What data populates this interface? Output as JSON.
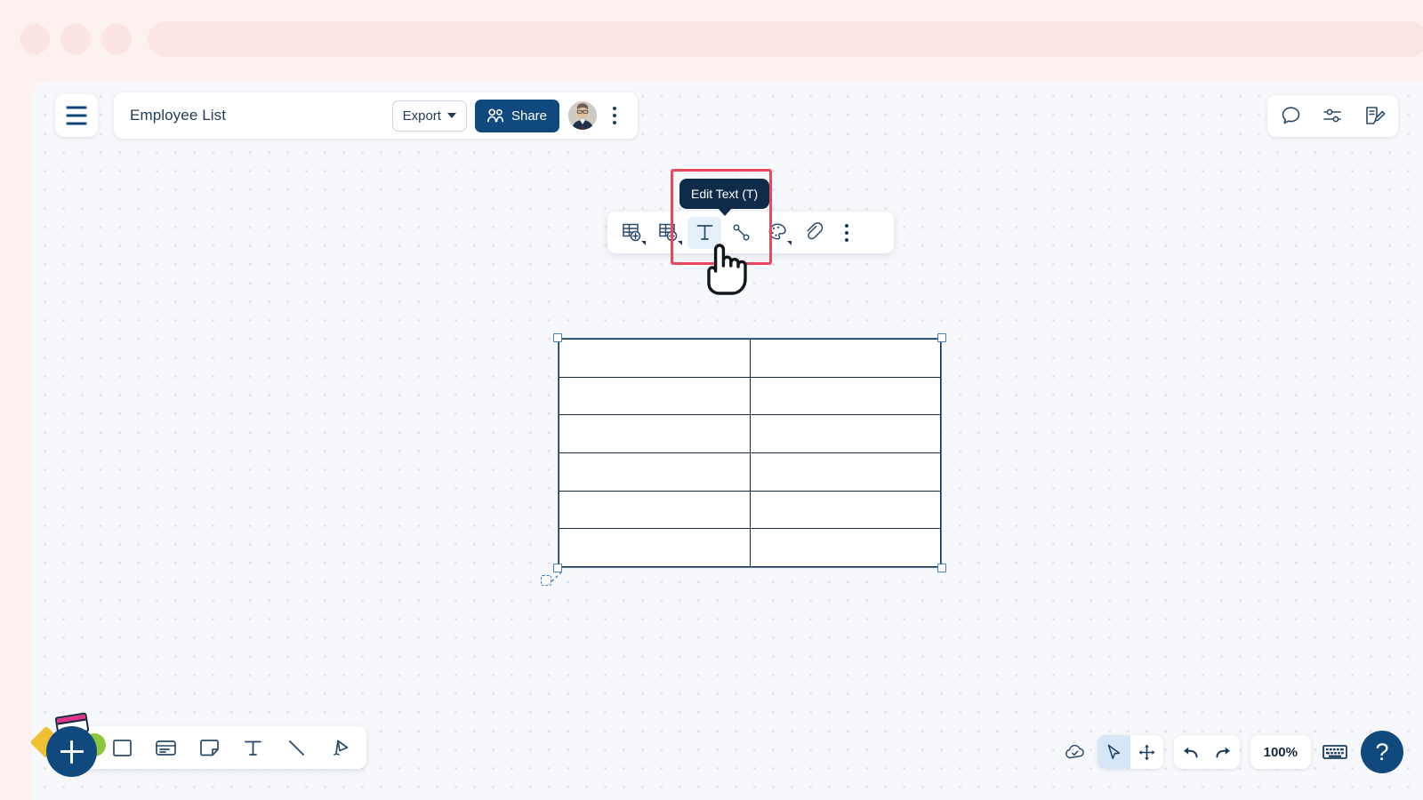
{
  "browser": {
    "dots": [
      "dot-1",
      "dot-2",
      "dot-3"
    ],
    "url_bar_placeholder": ""
  },
  "header": {
    "menu_icon": "hamburger-icon",
    "document_title": "Employee List",
    "export_label": "Export",
    "export_caret": "chevron-down-icon",
    "share_label": "Share",
    "share_icon": "people-icon",
    "avatar_name": "user-avatar",
    "more_icon": "kebab-menu-icon"
  },
  "top_right_tools": [
    {
      "name": "comment-icon",
      "label": "Comments"
    },
    {
      "name": "settings-sliders-icon",
      "label": "Settings"
    },
    {
      "name": "notes-edit-icon",
      "label": "Notes"
    }
  ],
  "element_toolbar": {
    "tooltip_text": "Edit Text (T)",
    "items": [
      {
        "name": "add-table-row-icon",
        "label": "Add Row/Column",
        "active": false,
        "has_dropdown": true
      },
      {
        "name": "remove-table-row-icon",
        "label": "Remove Row/Column",
        "active": false,
        "has_dropdown": true
      },
      {
        "name": "edit-text-icon",
        "label": "Edit Text",
        "active": true,
        "has_dropdown": false
      },
      {
        "name": "connector-line-icon",
        "label": "Connector",
        "active": false,
        "has_dropdown": false
      },
      {
        "name": "palette-icon",
        "label": "Color",
        "active": false,
        "has_dropdown": true
      },
      {
        "name": "link-icon",
        "label": "Link",
        "active": false,
        "has_dropdown": false
      },
      {
        "name": "more-options-icon",
        "label": "More",
        "active": false,
        "has_dropdown": false
      }
    ]
  },
  "canvas": {
    "selected_shape": "table",
    "table": {
      "rows": 6,
      "columns": 2,
      "cells": [
        [
          "",
          ""
        ],
        [
          "",
          ""
        ],
        [
          "",
          ""
        ],
        [
          "",
          ""
        ],
        [
          "",
          ""
        ],
        [
          "",
          ""
        ]
      ]
    },
    "handles": [
      "top-left",
      "top-right",
      "bottom-left",
      "bottom-right"
    ],
    "ghost_handle": "resize-ghost-handle",
    "cursor": "pointing-hand-cursor"
  },
  "bottom_dock": {
    "fab_label": "+",
    "fab_name": "add-element-fab",
    "tools": [
      {
        "name": "shape-rectangle-icon",
        "label": "Shape"
      },
      {
        "name": "card-icon",
        "label": "Card"
      },
      {
        "name": "sticky-note-icon",
        "label": "Sticky Note"
      },
      {
        "name": "text-icon",
        "label": "Text"
      },
      {
        "name": "line-icon",
        "label": "Line"
      },
      {
        "name": "marker-pen-icon",
        "label": "Pen"
      }
    ]
  },
  "bottom_right": {
    "save_status_icon": "cloud-saved-icon",
    "select_tool": {
      "name": "cursor-select-icon",
      "label": "Select",
      "active": true
    },
    "pan_tool": {
      "name": "pan-move-icon",
      "label": "Pan",
      "active": false
    },
    "undo": {
      "name": "undo-icon",
      "label": "Undo"
    },
    "redo": {
      "name": "redo-icon",
      "label": "Redo"
    },
    "zoom_level": "100%",
    "keyboard_icon": "keyboard-shortcuts-icon",
    "help_label": "?"
  },
  "colors": {
    "brand_navy": "#10497e",
    "dark_navy": "#15293f",
    "highlight_red": "#e8495a",
    "tooltip_bg": "#0e2c4a",
    "active_chip": "#e6f0fb",
    "canvas_bg": "#f7f8fb",
    "chrome_pink": "#fdf1f0"
  }
}
